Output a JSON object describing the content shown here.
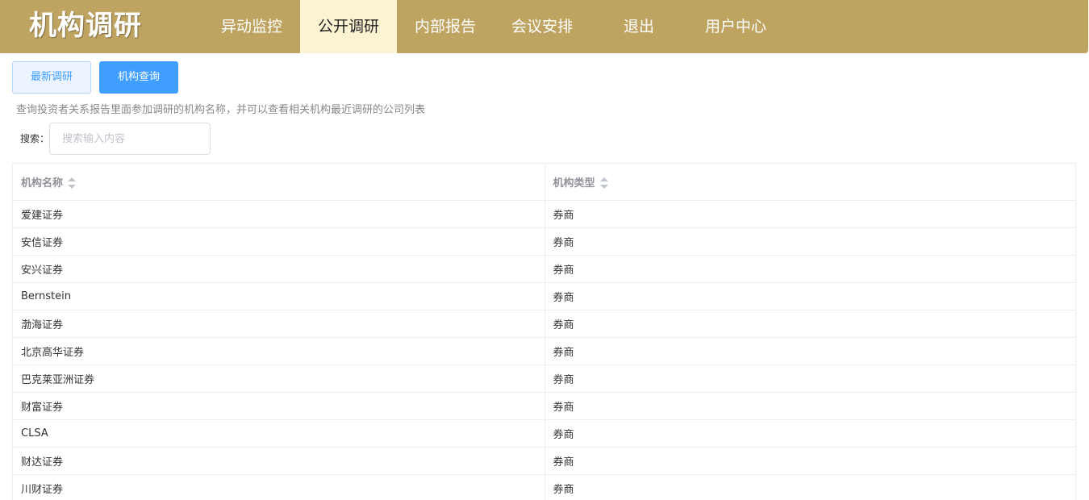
{
  "brand": "机构调研",
  "nav": [
    {
      "label": "异动监控",
      "active": false
    },
    {
      "label": "公开调研",
      "active": true
    },
    {
      "label": "内部报告",
      "active": false
    },
    {
      "label": "会议安排",
      "active": false
    },
    {
      "label": "退出",
      "active": false
    },
    {
      "label": "用户中心",
      "active": false
    }
  ],
  "buttons": {
    "latest": "最新调研",
    "query": "机构查询"
  },
  "description": "查询投资者关系报告里面参加调研的机构名称，并可以查看相关机构最近调研的公司列表",
  "search": {
    "label": "搜索：",
    "placeholder": "搜索输入内容",
    "value": ""
  },
  "table": {
    "headers": [
      "机构名称",
      "机构类型"
    ],
    "rows": [
      [
        "爱建证券",
        "券商"
      ],
      [
        "安信证券",
        "券商"
      ],
      [
        "安兴证券",
        "券商"
      ],
      [
        "Bernstein",
        "券商"
      ],
      [
        "渤海证券",
        "券商"
      ],
      [
        "北京高华证券",
        "券商"
      ],
      [
        "巴克莱亚洲证券",
        "券商"
      ],
      [
        "财富证券",
        "券商"
      ],
      [
        "CLSA",
        "券商"
      ],
      [
        "财达证券",
        "券商"
      ],
      [
        "川财证券",
        "券商"
      ]
    ]
  }
}
